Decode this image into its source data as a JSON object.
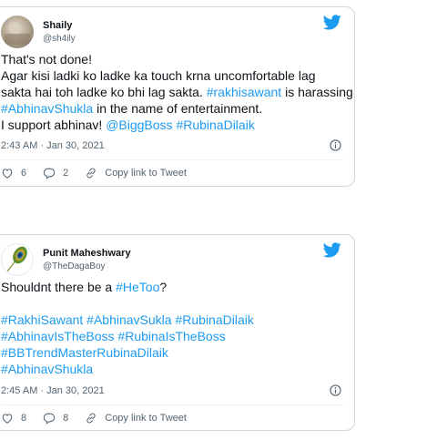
{
  "tweets": [
    {
      "author_name": "Shaily",
      "author_handle": "@sh4ily",
      "lines": [
        [
          {
            "t": "That's not done!"
          }
        ],
        [
          {
            "t": "Agar kisi ladki ko ladke ka touch krna uncomfortable lag"
          }
        ],
        [
          {
            "t": "sakta hai toh ladke ko bhi lag sakta. "
          },
          {
            "t": "#rakhisawant",
            "link": true
          },
          {
            "t": " is harassing"
          }
        ],
        [
          {
            "t": "#AbhinavShukla",
            "link": true
          },
          {
            "t": " in the name of entertainment."
          }
        ],
        [
          {
            "t": "I support abhinav! "
          },
          {
            "t": "@BiggBoss",
            "link": true
          },
          {
            "t": " "
          },
          {
            "t": "#RubinaDilaik",
            "link": true
          }
        ]
      ],
      "timestamp": "2:43 AM · Jan 30, 2021",
      "likes": "6",
      "replies": "2",
      "copy_link": "Copy link to Tweet"
    },
    {
      "author_name": "Punit Maheshwary",
      "author_handle": "@TheDagaBoy",
      "lines": [
        [
          {
            "t": "Shouldnt there be a "
          },
          {
            "t": "#HeToo",
            "link": true
          },
          {
            "t": "?"
          }
        ],
        [
          {
            "t": ""
          }
        ],
        [
          {
            "t": "#RakhiSawant",
            "link": true
          },
          {
            "t": " "
          },
          {
            "t": "#AbhinavSukla",
            "link": true
          },
          {
            "t": " "
          },
          {
            "t": "#RubinaDilaik",
            "link": true
          }
        ],
        [
          {
            "t": "#AbhinavIsTheBoss",
            "link": true
          },
          {
            "t": " "
          },
          {
            "t": "#RubinaIsTheBoss",
            "link": true
          }
        ],
        [
          {
            "t": "#BBTrendMasterRubinaDilaik",
            "link": true
          }
        ],
        [
          {
            "t": "#AbhinavShukla",
            "link": true
          }
        ]
      ],
      "timestamp": "2:45 AM · Jan 30, 2021",
      "likes": "8",
      "replies": "8",
      "copy_link": "Copy link to Tweet"
    }
  ],
  "colors": {
    "link": "#1d9bf0",
    "muted": "#536471",
    "text": "#0f1419",
    "border": "#cfd9de"
  },
  "icons": [
    "twitter-bird-icon",
    "info-icon",
    "heart-icon",
    "reply-icon",
    "link-icon"
  ]
}
